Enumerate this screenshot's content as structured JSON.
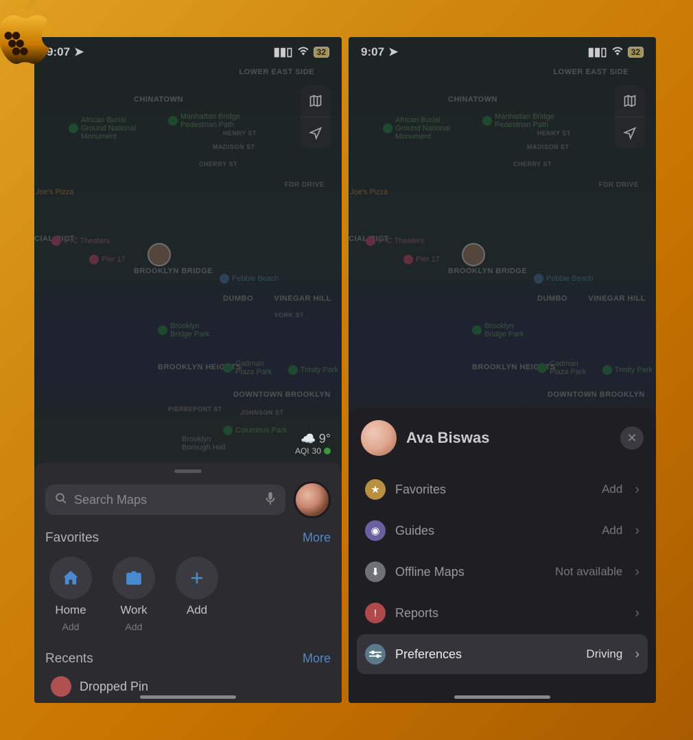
{
  "status": {
    "time": "9:07",
    "battery": "32"
  },
  "map": {
    "labels": {
      "lower_east": "LOWER\nEAST SIDE",
      "chinatown": "CHINATOWN",
      "brooklyn_bridge": "BROOKLYN\nBRIDGE",
      "dumbo": "DUMBO",
      "vinegar_hill": "VINEGAR HILL",
      "brooklyn_heights": "BROOKLYN\nHEIGHTS",
      "downtown_brooklyn": "DOWNTOWN\nBROOKLYN",
      "madison_st": "MADISON ST",
      "henry_st": "HENRY ST",
      "cherry_st": "CHERRY ST",
      "fdr_drive": "FDR DRIVE",
      "york_st": "YORK ST",
      "johnson_st": "JOHNSON ST",
      "pierrepont_st": "PIERREPONT ST",
      "financial_district": "CIAL\nRICT"
    },
    "pois": {
      "african_burial": "African Burial\nGround National\nMonument",
      "manhattan_bridge": "Manhattan Bridge\nPedestrian Path",
      "joes_pizza": "Joe's Pizza",
      "ipic": "iPIC Theaters",
      "pier17": "Pier 17",
      "pebble_beach": "Pebble Beach",
      "brooklyn_bridge_park": "Brooklyn\nBridge Park",
      "cadman_plaza": "Cadman\nPlaza Park",
      "trinity_park": "Trinity Park",
      "columbus_park": "Columbus Park",
      "borough_hall": "Brooklyn\nBorough Hall"
    },
    "weather": {
      "temp": "9°",
      "aqi_label": "AQI",
      "aqi_value": "30"
    }
  },
  "search": {
    "placeholder": "Search Maps"
  },
  "favorites": {
    "title": "Favorites",
    "more": "More",
    "home": {
      "label": "Home",
      "sub": "Add"
    },
    "work": {
      "label": "Work",
      "sub": "Add"
    },
    "add": {
      "label": "Add"
    }
  },
  "recents": {
    "title": "Recents",
    "more": "More",
    "dropped_pin": "Dropped Pin"
  },
  "profile": {
    "name": "Ava Biswas",
    "menu": {
      "favorites": {
        "label": "Favorites",
        "value": "Add"
      },
      "guides": {
        "label": "Guides",
        "value": "Add"
      },
      "offline": {
        "label": "Offline Maps",
        "value": "Not available"
      },
      "reports": {
        "label": "Reports"
      },
      "prefs": {
        "label": "Preferences",
        "value": "Driving"
      }
    }
  }
}
